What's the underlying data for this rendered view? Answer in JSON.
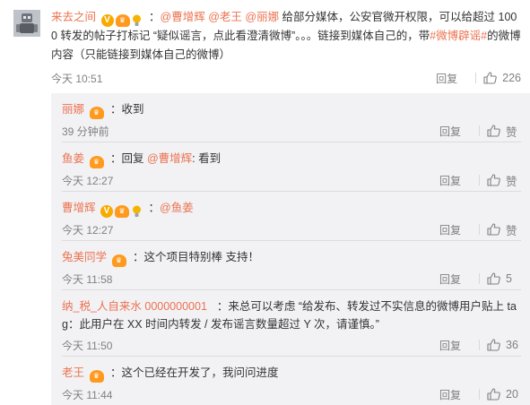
{
  "colors": {
    "username": "#eb7350",
    "mention": "#eb7350",
    "meta_text": "#808080",
    "panel_bg": "#f2f2f5",
    "divider": "#dcdcdc",
    "badge_v": "#f7ab00",
    "badge_crown": "#ff9a1f",
    "badge_bulb": "#f4b400"
  },
  "icons": {
    "like": "thumbs-up-icon",
    "avatar": "robot-figure-avatar"
  },
  "top_comment": {
    "username": "来去之间",
    "badges": [
      {
        "type": "v",
        "label": "V"
      },
      {
        "type": "crown",
        "label": "♛"
      },
      {
        "type": "bulb",
        "label": ""
      }
    ],
    "segments": [
      {
        "kind": "text",
        "value": "："
      },
      {
        "kind": "mention",
        "value": "@曹增辉"
      },
      {
        "kind": "text",
        "value": " "
      },
      {
        "kind": "mention",
        "value": "@老王"
      },
      {
        "kind": "text",
        "value": " "
      },
      {
        "kind": "mention",
        "value": "@丽娜"
      },
      {
        "kind": "text",
        "value": " 给部分媒体，公安官微开权限，可以给超过 1000 转发的帖子打标记 “疑似谣言，点此看澄清微博”。。。链接到媒体自己的，带"
      },
      {
        "kind": "topic",
        "value": "#微博辟谣#"
      },
      {
        "kind": "text",
        "value": "的微博内容（只能链接到媒体自己的微博）"
      }
    ],
    "time": "今天 10:51",
    "reply_label": "回复",
    "like_label": "226"
  },
  "replies": [
    {
      "username": "丽娜",
      "badges": [
        {
          "type": "crown",
          "label": "♛"
        }
      ],
      "segments": [
        {
          "kind": "text",
          "value": "：收到"
        }
      ],
      "time": "39 分钟前",
      "reply_label": "回复",
      "like_label": "赞"
    },
    {
      "username": "鱼姜",
      "badges": [
        {
          "type": "crown",
          "label": "♛"
        }
      ],
      "segments": [
        {
          "kind": "text",
          "value": "：回复 "
        },
        {
          "kind": "mention",
          "value": "@曹增辉"
        },
        {
          "kind": "text",
          "value": ": 看到"
        }
      ],
      "time": "今天 12:27",
      "reply_label": "回复",
      "like_label": "赞"
    },
    {
      "username": "曹增辉",
      "badges": [
        {
          "type": "v",
          "label": "V"
        },
        {
          "type": "crown",
          "label": "♛"
        },
        {
          "type": "bulb",
          "label": ""
        }
      ],
      "segments": [
        {
          "kind": "text",
          "value": "："
        },
        {
          "kind": "mention",
          "value": "@鱼姜"
        }
      ],
      "time": "今天 12:27",
      "reply_label": "回复",
      "like_label": "赞"
    },
    {
      "username": "兔美同学",
      "badges": [
        {
          "type": "crown",
          "label": "♛"
        }
      ],
      "segments": [
        {
          "kind": "text",
          "value": "：这个项目特别棒 支持！"
        }
      ],
      "time": "今天 11:58",
      "reply_label": "回复",
      "like_label": "5"
    },
    {
      "username": "纳_税_人自来水 0000000001",
      "badges": [],
      "segments": [
        {
          "kind": "text",
          "value": "：来总可以考虑 “给发布、转发过不实信息的微博用户贴上 tag：此用户在 XX 时间内转发 / 发布谣言数量超过 Y 次，请谨慎。”"
        }
      ],
      "time": "今天 11:50",
      "reply_label": "回复",
      "like_label": "36"
    },
    {
      "username": "老王",
      "badges": [
        {
          "type": "crown",
          "label": "♛"
        }
      ],
      "segments": [
        {
          "kind": "text",
          "value": "：这个已经在开发了，我问问进度"
        }
      ],
      "time": "今天 11:44",
      "reply_label": "回复",
      "like_label": "20"
    }
  ]
}
